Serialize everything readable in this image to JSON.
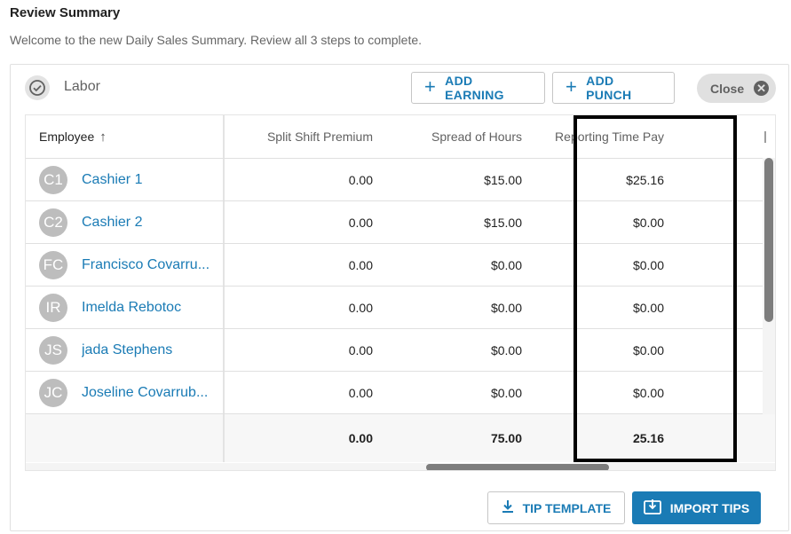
{
  "header": {
    "title": "Review Summary",
    "subtitle": "Welcome to the new Daily Sales Summary. Review all 3 steps to complete."
  },
  "section": {
    "label": "Labor",
    "status_icon": "check-circle-icon"
  },
  "toolbar": {
    "add_earning_label": "ADD EARNING",
    "add_punch_label": "ADD PUNCH",
    "close_label": "Close"
  },
  "table": {
    "columns": [
      "Employee",
      "Split Shift Premium",
      "Spread of Hours",
      "Reporting Time Pay"
    ],
    "rows": [
      {
        "initials": "C1",
        "name": "Cashier 1",
        "split_shift_premium": "0.00",
        "spread_of_hours": "$15.00",
        "reporting_time_pay": "$25.16"
      },
      {
        "initials": "C2",
        "name": "Cashier 2",
        "split_shift_premium": "0.00",
        "spread_of_hours": "$15.00",
        "reporting_time_pay": "$0.00"
      },
      {
        "initials": "FC",
        "name": "Francisco Covarru...",
        "split_shift_premium": "0.00",
        "spread_of_hours": "$0.00",
        "reporting_time_pay": "$0.00"
      },
      {
        "initials": "IR",
        "name": "Imelda Rebotoc",
        "split_shift_premium": "0.00",
        "spread_of_hours": "$0.00",
        "reporting_time_pay": "$0.00"
      },
      {
        "initials": "JS",
        "name": "jada Stephens",
        "split_shift_premium": "0.00",
        "spread_of_hours": "$0.00",
        "reporting_time_pay": "$0.00"
      },
      {
        "initials": "JC",
        "name": "Joseline Covarrub...",
        "split_shift_premium": "0.00",
        "spread_of_hours": "$0.00",
        "reporting_time_pay": "$0.00"
      }
    ],
    "totals": {
      "split_shift_premium": "0.00",
      "spread_of_hours": "75.00",
      "reporting_time_pay": "25.16"
    }
  },
  "footer": {
    "tip_template_label": "TIP TEMPLATE",
    "import_tips_label": "IMPORT TIPS"
  },
  "colors": {
    "accent": "#1a7bb5",
    "avatar": "#bdbdbd",
    "highlight": "#000000"
  }
}
